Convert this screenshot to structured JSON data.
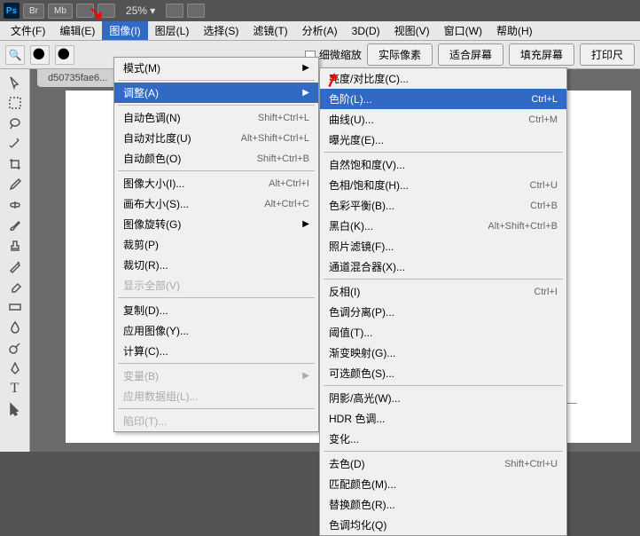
{
  "titlebar": {
    "ps": "Ps",
    "btn1": "Br",
    "btn2": "Mb",
    "zoom": "25%"
  },
  "menubar": [
    "文件(F)",
    "编辑(E)",
    "图像(I)",
    "图层(L)",
    "选择(S)",
    "滤镜(T)",
    "分析(A)",
    "3D(D)",
    "视图(V)",
    "窗口(W)",
    "帮助(H)"
  ],
  "menuActive": 2,
  "optionbar": {
    "checkbox": "细微缩放",
    "btns": [
      "实际像素",
      "适合屏幕",
      "填充屏幕",
      "打印尺"
    ]
  },
  "tab": "d50735fae6...",
  "dd1": [
    {
      "t": "模式(M)",
      "arrow": true
    },
    {
      "sep": true
    },
    {
      "t": "调整(A)",
      "arrow": true,
      "hover": true
    },
    {
      "sep": true
    },
    {
      "t": "自动色调(N)",
      "s": "Shift+Ctrl+L"
    },
    {
      "t": "自动对比度(U)",
      "s": "Alt+Shift+Ctrl+L"
    },
    {
      "t": "自动颜色(O)",
      "s": "Shift+Ctrl+B"
    },
    {
      "sep": true
    },
    {
      "t": "图像大小(I)...",
      "s": "Alt+Ctrl+I"
    },
    {
      "t": "画布大小(S)...",
      "s": "Alt+Ctrl+C"
    },
    {
      "t": "图像旋转(G)",
      "arrow": true
    },
    {
      "t": "裁剪(P)"
    },
    {
      "t": "裁切(R)..."
    },
    {
      "t": "显示全部(V)",
      "disabled": true
    },
    {
      "sep": true
    },
    {
      "t": "复制(D)..."
    },
    {
      "t": "应用图像(Y)..."
    },
    {
      "t": "计算(C)..."
    },
    {
      "sep": true
    },
    {
      "t": "变量(B)",
      "arrow": true,
      "disabled": true
    },
    {
      "t": "应用数据组(L)...",
      "disabled": true
    },
    {
      "sep": true
    },
    {
      "t": "陷印(T)...",
      "disabled": true
    }
  ],
  "dd2": [
    {
      "t": "亮度/对比度(C)..."
    },
    {
      "t": "色阶(L)...",
      "s": "Ctrl+L",
      "hover": true
    },
    {
      "t": "曲线(U)...",
      "s": "Ctrl+M"
    },
    {
      "t": "曝光度(E)..."
    },
    {
      "sep": true
    },
    {
      "t": "自然饱和度(V)..."
    },
    {
      "t": "色相/饱和度(H)...",
      "s": "Ctrl+U"
    },
    {
      "t": "色彩平衡(B)...",
      "s": "Ctrl+B"
    },
    {
      "t": "黑白(K)...",
      "s": "Alt+Shift+Ctrl+B"
    },
    {
      "t": "照片滤镜(F)..."
    },
    {
      "t": "通道混合器(X)..."
    },
    {
      "sep": true
    },
    {
      "t": "反相(I)",
      "s": "Ctrl+I"
    },
    {
      "t": "色调分离(P)..."
    },
    {
      "t": "阈值(T)..."
    },
    {
      "t": "渐变映射(G)..."
    },
    {
      "t": "可选颜色(S)..."
    },
    {
      "sep": true
    },
    {
      "t": "阴影/高光(W)..."
    },
    {
      "t": "HDR 色调..."
    },
    {
      "t": "变化..."
    },
    {
      "sep": true
    },
    {
      "t": "去色(D)",
      "s": "Shift+Ctrl+U"
    },
    {
      "t": "匹配颜色(M)..."
    },
    {
      "t": "替换颜色(R)..."
    },
    {
      "t": "色调均化(Q)"
    }
  ]
}
